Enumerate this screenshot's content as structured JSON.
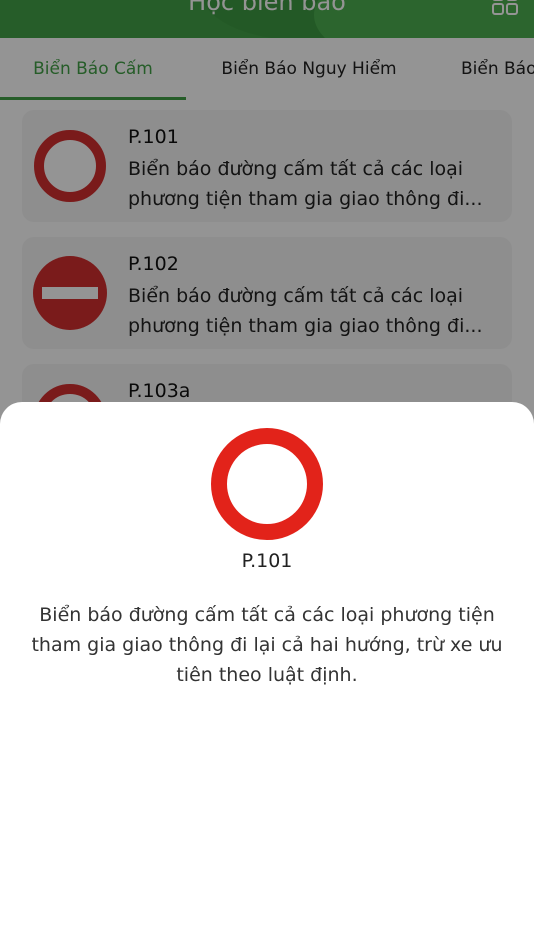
{
  "header": {
    "title": "Học biển báo",
    "menu_icon": "grid-icon"
  },
  "tabs": [
    {
      "label": "Biển Báo Cấm",
      "active": true
    },
    {
      "label": "Biển Báo Nguy Hiểm",
      "active": false
    },
    {
      "label": "Biển Báo",
      "active": false
    }
  ],
  "list": [
    {
      "code": "P.101",
      "description": "Biển báo đường cấm tất cả các loại phương tiện tham gia giao thông đi...",
      "icon": "no-entry-all-vehicles-sign"
    },
    {
      "code": "P.102",
      "description": "Biển báo đường cấm tất cả các loại phương tiện tham gia giao thông đi...",
      "icon": "no-entry-sign"
    },
    {
      "code": "P.103a",
      "description": "",
      "icon": "prohibition-sign"
    }
  ],
  "detail": {
    "code": "P.101",
    "description": "Biển báo đường cấm tất cả các loại phương tiện tham gia giao thông đi lại cả hai hướng, trừ xe ưu tiên theo luật định.",
    "icon": "no-entry-all-vehicles-sign"
  },
  "colors": {
    "brand_green": "#43a047",
    "sign_red": "#d32f2f",
    "sheet_red": "#e2231a"
  }
}
